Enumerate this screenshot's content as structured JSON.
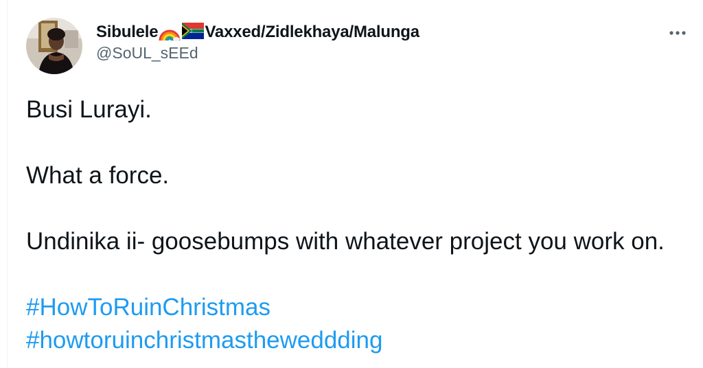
{
  "tweet": {
    "author": {
      "display_name_start": "Sibulele",
      "display_name_end": "Vaxxed/Zidlekhaya/Malunga",
      "handle": "@SoUL_sEEd",
      "emoji": [
        "rainbow-emoji",
        "south-africa-flag-emoji"
      ]
    },
    "more_icon": "more-horizontal-icon",
    "paragraphs": [
      "Busi Lurayi.",
      "What a force.",
      "Undinika ii- goosebumps with whatever project you work on."
    ],
    "hashtags": [
      "#HowToRuinChristmas",
      "#howtoruinchristmastheweddding"
    ],
    "colors": {
      "text": "#0f1419",
      "secondary": "#536471",
      "link": "#1d9bf0"
    }
  }
}
